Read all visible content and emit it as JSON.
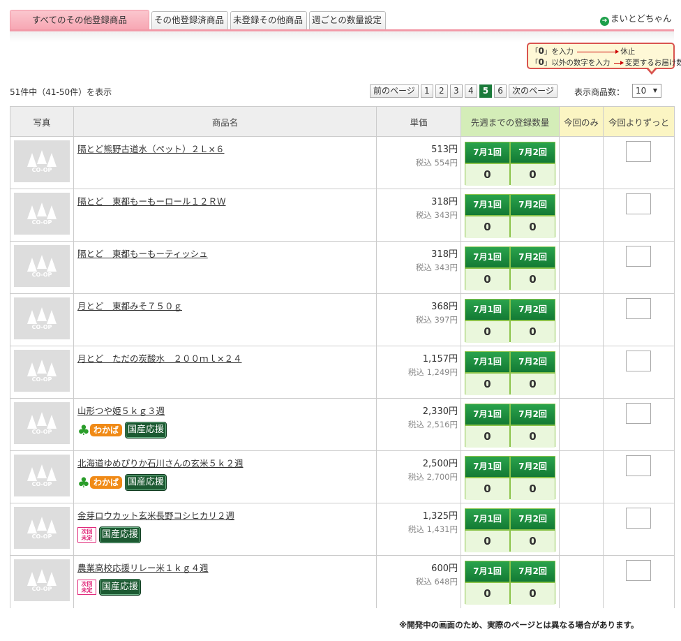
{
  "tabs": [
    {
      "label": "すべてのその他登録商品",
      "active": true
    },
    {
      "label": "その他登録済商品"
    },
    {
      "label": "未登録その他商品"
    },
    {
      "label": "週ごとの数量設定"
    }
  ],
  "my_link": "まいとどちゃん",
  "legend": {
    "row1_q1": "「",
    "row1_zero": "0",
    "row1_q2": "」を入力",
    "row1_result": "休止",
    "row2_q1": "「",
    "row2_zero": "0",
    "row2_q2": "」以外の数字を入力",
    "row2_result": "変更するお届け数"
  },
  "result_count": "51件中（41-50件）を表示",
  "pager": {
    "prev": "前のページ",
    "pages": [
      "1",
      "2",
      "3",
      "4",
      "5",
      "6"
    ],
    "current": "5",
    "next": "次のページ",
    "per_page_label": "表示商品数：",
    "per_page_value": "10"
  },
  "columns": {
    "photo": "写真",
    "name": "商品名",
    "price": "単価",
    "registered": "先週までの登録数量",
    "once": "今回のみ",
    "always": "今回よりずっと"
  },
  "photo_placeholder": "CO-OP",
  "reg_labels": [
    "7月1回",
    "7月2回"
  ],
  "badges": {
    "wakaba": "わかば",
    "kokusan": "国産応援",
    "next1": "次回",
    "next2": "未定"
  },
  "products": [
    {
      "name": "隔とど熊野古道水（ペット）２Ｌ×６",
      "price": "513円",
      "tax": "税込 554円",
      "qty": [
        "0",
        "0"
      ],
      "badges": []
    },
    {
      "name": "隔とど　東都もーもーロール１２ＲＷ",
      "price": "318円",
      "tax": "税込 343円",
      "qty": [
        "0",
        "0"
      ],
      "badges": []
    },
    {
      "name": "隔とど　東都もーもーティッシュ",
      "price": "318円",
      "tax": "税込 343円",
      "qty": [
        "0",
        "0"
      ],
      "badges": []
    },
    {
      "name": "月とど　東都みそ７５０ｇ",
      "price": "368円",
      "tax": "税込 397円",
      "qty": [
        "0",
        "0"
      ],
      "badges": []
    },
    {
      "name": "月とど　ただの炭酸水　２００ｍｌ×２４",
      "price": "1,157円",
      "tax": "税込 1,249円",
      "qty": [
        "0",
        "0"
      ],
      "badges": []
    },
    {
      "name": "山形つや姫５ｋｇ３週",
      "price": "2,330円",
      "tax": "税込 2,516円",
      "qty": [
        "0",
        "0"
      ],
      "badges": [
        "wakaba",
        "kokusan"
      ]
    },
    {
      "name": "北海道ゆめぴりか石川さんの玄米５ｋ２週",
      "price": "2,500円",
      "tax": "税込 2,700円",
      "qty": [
        "0",
        "0"
      ],
      "badges": [
        "wakaba",
        "kokusan"
      ]
    },
    {
      "name": "金芽ロウカット玄米長野コシヒカリ２週",
      "price": "1,325円",
      "tax": "税込 1,431円",
      "qty": [
        "0",
        "0"
      ],
      "badges": [
        "next",
        "kokusan"
      ]
    },
    {
      "name": "農業高校応援リレー米１ｋｇ４週",
      "price": "600円",
      "tax": "税込 648円",
      "qty": [
        "0",
        "0"
      ],
      "badges": [
        "next",
        "kokusan"
      ]
    }
  ],
  "footer_note": "※開発中の画面のため、実際のページとは異なる場合があります。"
}
